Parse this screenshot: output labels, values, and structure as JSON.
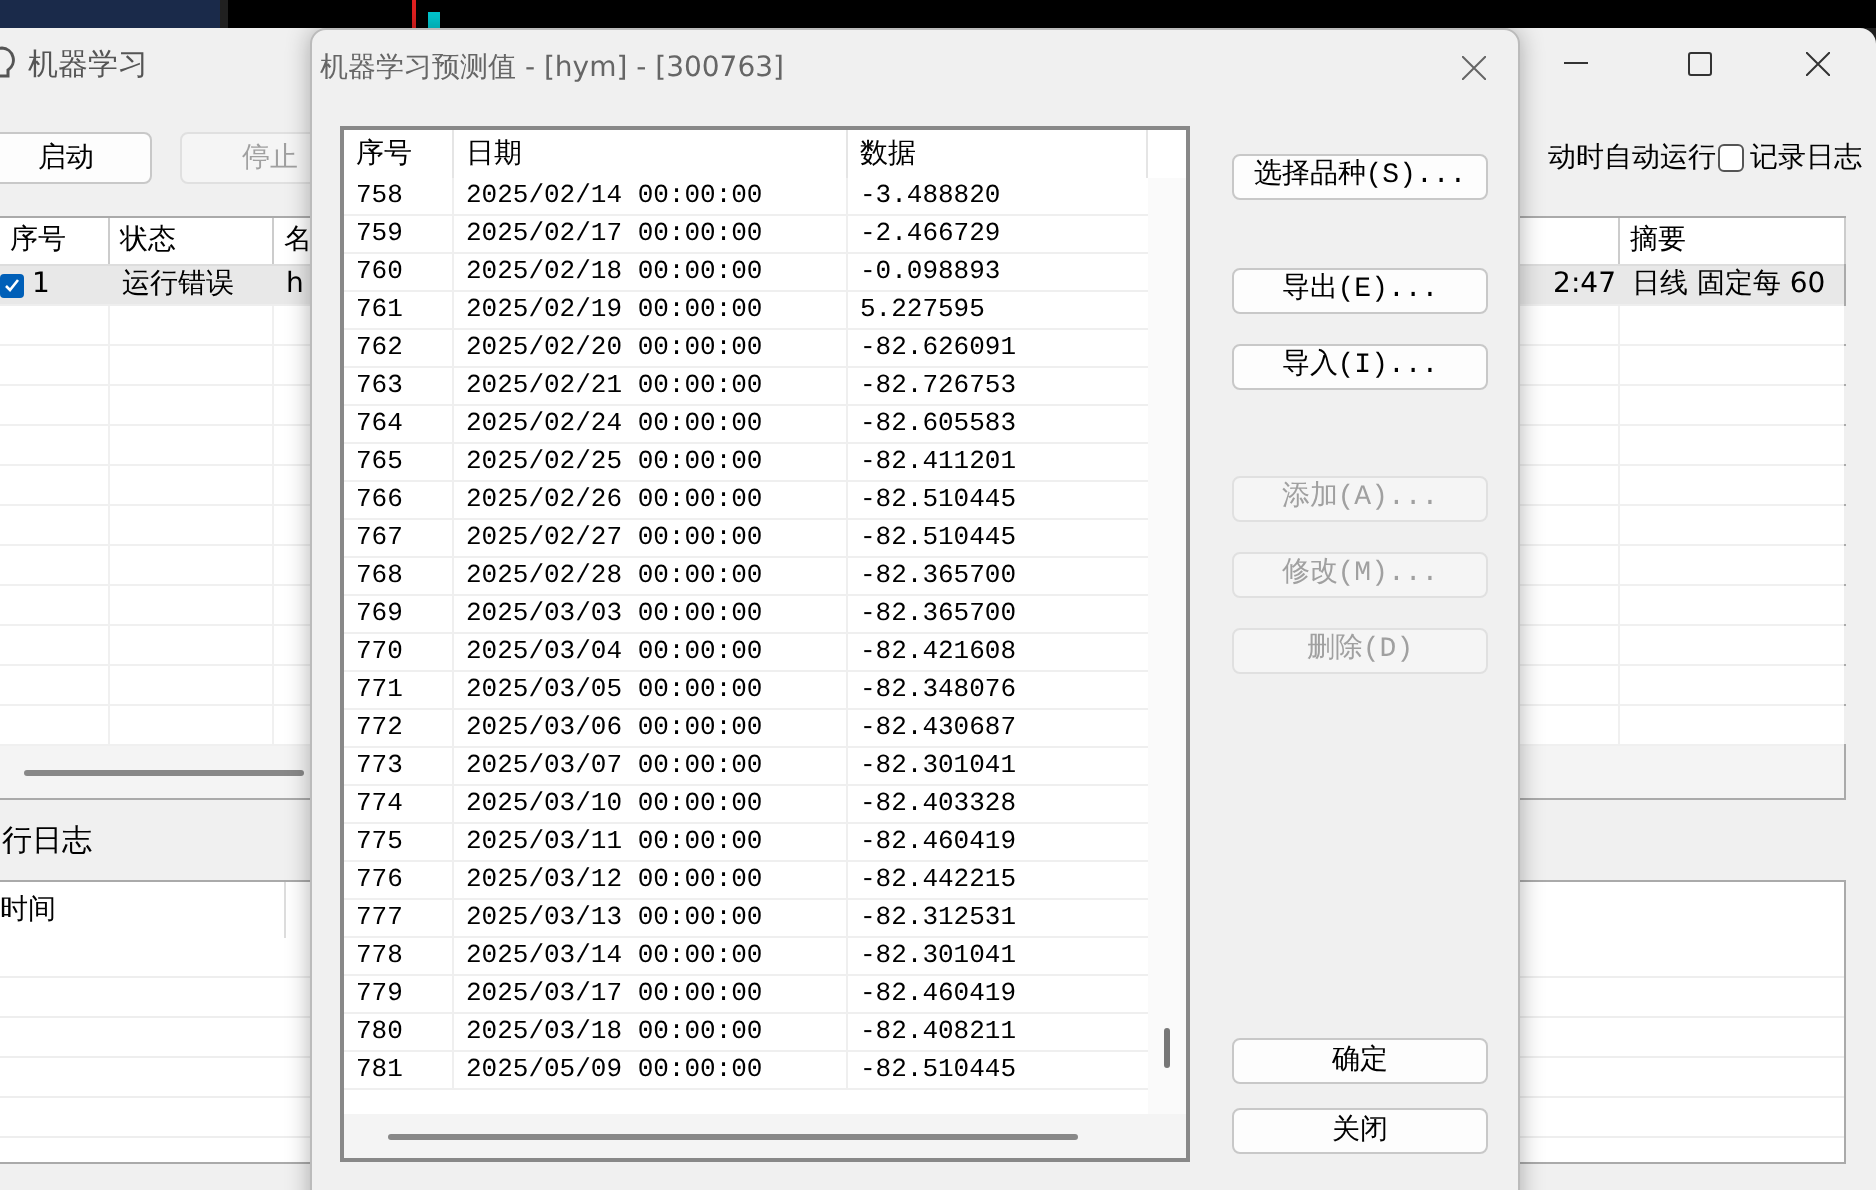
{
  "main_window": {
    "title": "机器学习",
    "toolbar": [
      {
        "label": "启动",
        "disabled": false
      },
      {
        "label": "停止",
        "disabled": true
      }
    ],
    "auto_run_label": "动时自动运行",
    "log_option": {
      "label": "记录日志",
      "checked": false
    },
    "table": {
      "columns": [
        "序号",
        "状态",
        "名",
        "",
        "摘要"
      ],
      "rows": [
        {
          "checked": true,
          "selected": true,
          "cells": [
            "1",
            "运行错误",
            "h",
            "2:47",
            "日线  固定每 60"
          ]
        }
      ]
    },
    "log_title": "行日志",
    "log_table": {
      "columns": [
        "时间"
      ]
    }
  },
  "dialog": {
    "title": "机器学习预测值 - [hym] - [300763]",
    "list": {
      "columns": [
        "序号",
        "日期",
        "数据"
      ],
      "rows": [
        [
          "758",
          "2025/02/14 00:00:00",
          "-3.488820"
        ],
        [
          "759",
          "2025/02/17 00:00:00",
          "-2.466729"
        ],
        [
          "760",
          "2025/02/18 00:00:00",
          "-0.098893"
        ],
        [
          "761",
          "2025/02/19 00:00:00",
          "5.227595"
        ],
        [
          "762",
          "2025/02/20 00:00:00",
          "-82.626091"
        ],
        [
          "763",
          "2025/02/21 00:00:00",
          "-82.726753"
        ],
        [
          "764",
          "2025/02/24 00:00:00",
          "-82.605583"
        ],
        [
          "765",
          "2025/02/25 00:00:00",
          "-82.411201"
        ],
        [
          "766",
          "2025/02/26 00:00:00",
          "-82.510445"
        ],
        [
          "767",
          "2025/02/27 00:00:00",
          "-82.510445"
        ],
        [
          "768",
          "2025/02/28 00:00:00",
          "-82.365700"
        ],
        [
          "769",
          "2025/03/03 00:00:00",
          "-82.365700"
        ],
        [
          "770",
          "2025/03/04 00:00:00",
          "-82.421608"
        ],
        [
          "771",
          "2025/03/05 00:00:00",
          "-82.348076"
        ],
        [
          "772",
          "2025/03/06 00:00:00",
          "-82.430687"
        ],
        [
          "773",
          "2025/03/07 00:00:00",
          "-82.301041"
        ],
        [
          "774",
          "2025/03/10 00:00:00",
          "-82.403328"
        ],
        [
          "775",
          "2025/03/11 00:00:00",
          "-82.460419"
        ],
        [
          "776",
          "2025/03/12 00:00:00",
          "-82.442215"
        ],
        [
          "777",
          "2025/03/13 00:00:00",
          "-82.312531"
        ],
        [
          "778",
          "2025/03/14 00:00:00",
          "-82.301041"
        ],
        [
          "779",
          "2025/03/17 00:00:00",
          "-82.460419"
        ],
        [
          "780",
          "2025/03/18 00:00:00",
          "-82.408211"
        ],
        [
          "781",
          "2025/05/09 00:00:00",
          "-82.510445"
        ]
      ]
    },
    "buttons": [
      {
        "label": "选择品种(S)...",
        "disabled": false
      },
      {
        "label": "导出(E)...",
        "disabled": false
      },
      {
        "label": "导入(I)...",
        "disabled": false
      },
      {
        "label": "添加(A)...",
        "disabled": true
      },
      {
        "label": "修改(M)...",
        "disabled": true
      },
      {
        "label": "删除(D)",
        "disabled": true
      },
      {
        "label": "确定",
        "disabled": false
      },
      {
        "label": "关闭",
        "disabled": false
      }
    ]
  }
}
